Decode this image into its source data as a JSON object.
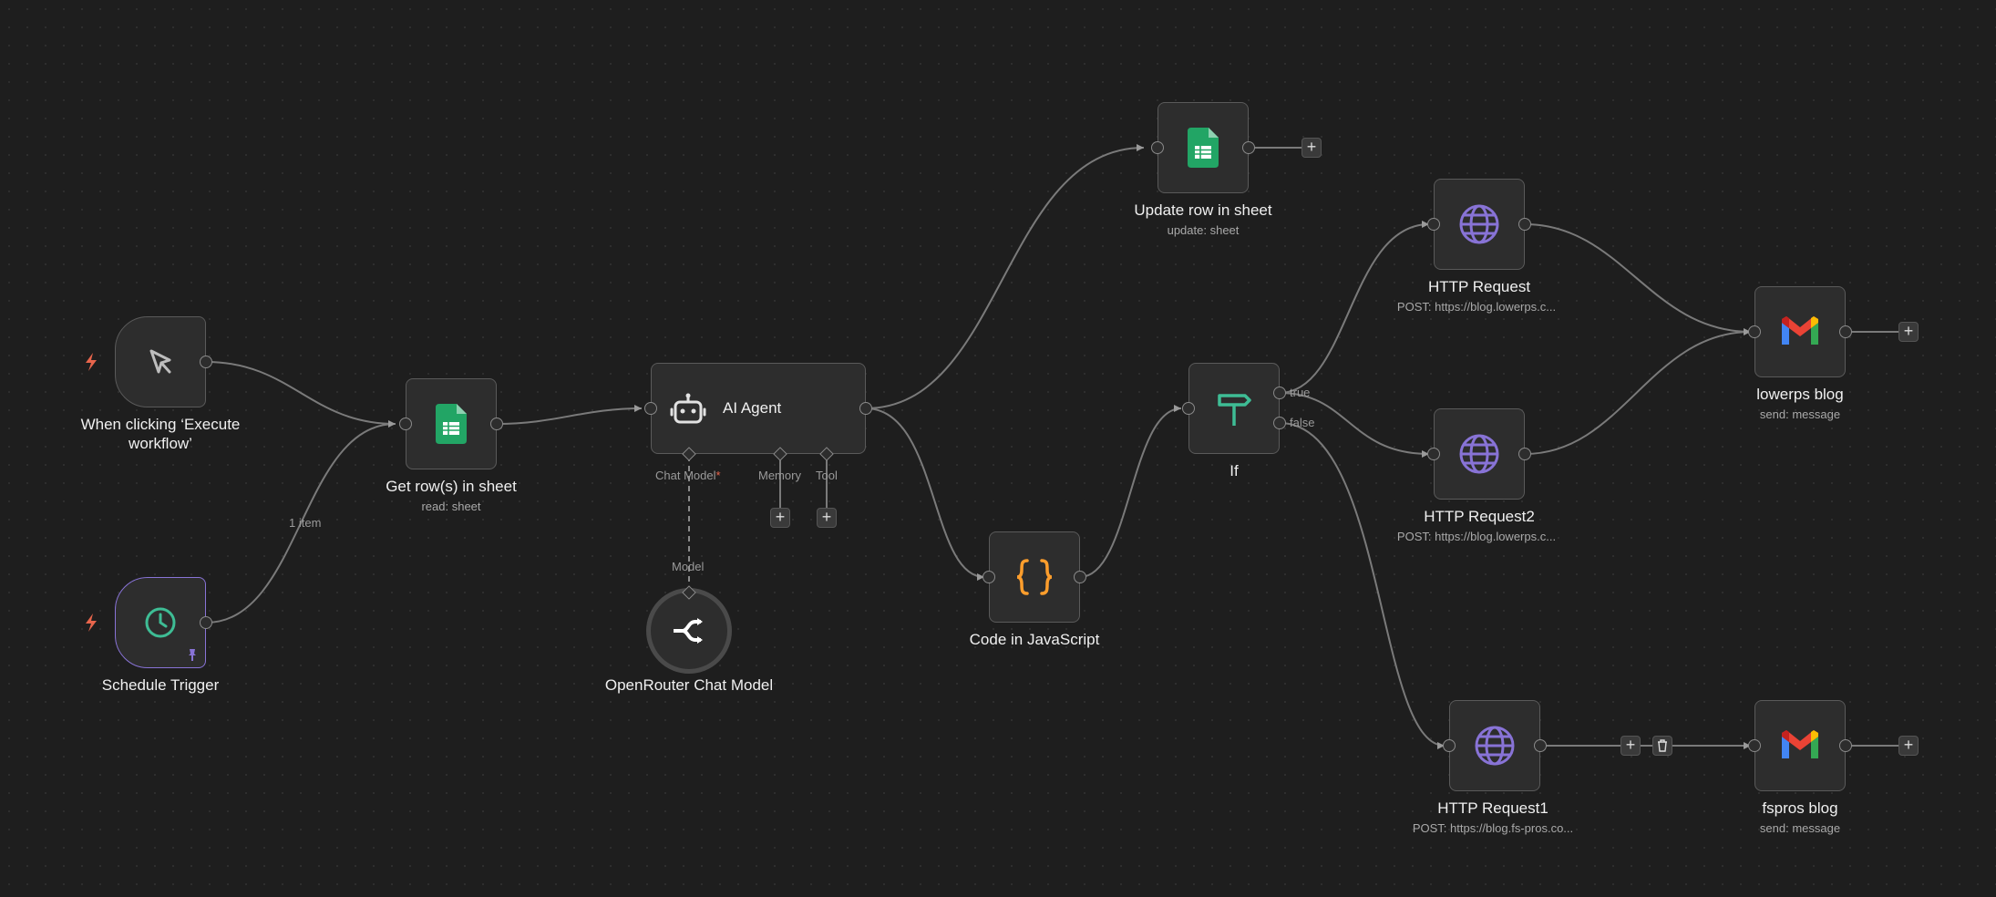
{
  "canvas": {
    "background": "#1e1e1e",
    "accent_purple": "#8873d6",
    "connection_color": "#7a7a7a"
  },
  "nodes": {
    "manual_trigger": {
      "title": "When clicking ‘Execute workflow’",
      "icon": "cursor-icon"
    },
    "schedule_trigger": {
      "title": "Schedule Trigger",
      "icon": "clock-icon",
      "pinned": true
    },
    "get_rows": {
      "title": "Get row(s) in sheet",
      "subtitle": "read: sheet",
      "icon": "google-sheets-icon"
    },
    "ai_agent": {
      "title": "AI Agent",
      "icon": "robot-icon",
      "inputs": {
        "chat_model": "Chat Model",
        "chat_model_required": "*",
        "memory": "Memory",
        "tool": "Tool"
      }
    },
    "openrouter": {
      "title": "OpenRouter Chat Model",
      "icon": "openrouter-icon",
      "port_label": "Model"
    },
    "update_row": {
      "title": "Update row in sheet",
      "subtitle": "update: sheet",
      "icon": "google-sheets-icon"
    },
    "code_js": {
      "title": "Code in JavaScript",
      "icon": "braces-icon"
    },
    "if_node": {
      "title": "If",
      "icon": "signpost-icon",
      "true_label": "true",
      "false_label": "false"
    },
    "http_request": {
      "title": "HTTP Request",
      "subtitle": "POST: https://blog.lowerps.c...",
      "icon": "globe-icon"
    },
    "http_request2": {
      "title": "HTTP Request2",
      "subtitle": "POST: https://blog.lowerps.c...",
      "icon": "globe-icon"
    },
    "http_request1": {
      "title": "HTTP Request1",
      "subtitle": "POST: https://blog.fs-pros.co...",
      "icon": "globe-icon"
    },
    "lowerps_blog": {
      "title": "lowerps blog",
      "subtitle": "send: message",
      "icon": "gmail-icon"
    },
    "fspros_blog": {
      "title": "fspros blog",
      "subtitle": "send: message",
      "icon": "gmail-icon"
    }
  },
  "edges": {
    "schedule_to_get_rows_label": "1 item"
  },
  "controls": {
    "add_symbol": "+"
  }
}
